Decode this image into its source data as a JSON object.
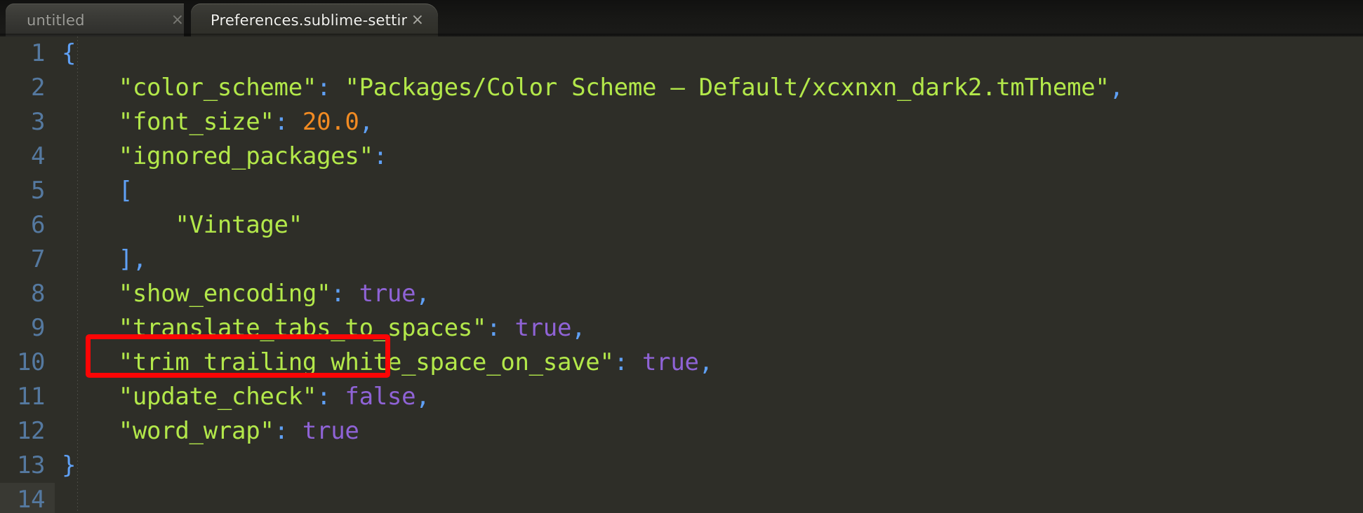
{
  "window": {
    "app": "Sublime Text",
    "theme_bg": "#2e2e28"
  },
  "tabbar": {
    "tabs": [
      {
        "label": "untitled",
        "close_glyph": "×",
        "active": false
      },
      {
        "label": "Preferences.sublime-settings",
        "close_glyph": "×",
        "active": true
      }
    ]
  },
  "editor": {
    "active_line": 14,
    "colors": {
      "background": "#2e2e28",
      "gutter_text": "#5579a0",
      "string": "#b3e84a",
      "punctuation": "#5fa0f5",
      "number": "#f28b22",
      "keyword": "#8f63d6",
      "annotation": "#fc0505"
    },
    "lines": [
      {
        "n": "1",
        "tokens": [
          {
            "t": "{",
            "c": "s-brk"
          }
        ]
      },
      {
        "n": "2",
        "tokens": [
          {
            "t": "    ",
            "c": ""
          },
          {
            "t": "\"color_scheme\"",
            "c": "s-str"
          },
          {
            "t": ":",
            "c": "s-pun"
          },
          {
            "t": " ",
            "c": ""
          },
          {
            "t": "\"Packages/Color Scheme – Default/xcxnxn_dark2.tmTheme\"",
            "c": "s-str"
          },
          {
            "t": ",",
            "c": "s-pun"
          }
        ]
      },
      {
        "n": "3",
        "tokens": [
          {
            "t": "    ",
            "c": ""
          },
          {
            "t": "\"font_size\"",
            "c": "s-str"
          },
          {
            "t": ":",
            "c": "s-pun"
          },
          {
            "t": " ",
            "c": ""
          },
          {
            "t": "20.0",
            "c": "s-num"
          },
          {
            "t": ",",
            "c": "s-pun"
          }
        ]
      },
      {
        "n": "4",
        "tokens": [
          {
            "t": "    ",
            "c": ""
          },
          {
            "t": "\"ignored_packages\"",
            "c": "s-str"
          },
          {
            "t": ":",
            "c": "s-pun"
          }
        ]
      },
      {
        "n": "5",
        "tokens": [
          {
            "t": "    ",
            "c": ""
          },
          {
            "t": "[",
            "c": "s-brk"
          }
        ]
      },
      {
        "n": "6",
        "tokens": [
          {
            "t": "        ",
            "c": ""
          },
          {
            "t": "\"Vintage\"",
            "c": "s-str"
          }
        ]
      },
      {
        "n": "7",
        "tokens": [
          {
            "t": "    ",
            "c": ""
          },
          {
            "t": "]",
            "c": "s-brk"
          },
          {
            "t": ",",
            "c": "s-pun"
          }
        ]
      },
      {
        "n": "8",
        "tokens": [
          {
            "t": "    ",
            "c": ""
          },
          {
            "t": "\"show_encoding\"",
            "c": "s-str"
          },
          {
            "t": ":",
            "c": "s-pun"
          },
          {
            "t": " ",
            "c": ""
          },
          {
            "t": "true",
            "c": "s-key"
          },
          {
            "t": ",",
            "c": "s-pun"
          }
        ]
      },
      {
        "n": "9",
        "tokens": [
          {
            "t": "    ",
            "c": ""
          },
          {
            "t": "\"translate_tabs_to_spaces\"",
            "c": "s-str"
          },
          {
            "t": ":",
            "c": "s-pun"
          },
          {
            "t": " ",
            "c": ""
          },
          {
            "t": "true",
            "c": "s-key"
          },
          {
            "t": ",",
            "c": "s-pun"
          }
        ]
      },
      {
        "n": "10",
        "tokens": [
          {
            "t": "    ",
            "c": ""
          },
          {
            "t": "\"trim_trailing_white_space_on_save\"",
            "c": "s-str"
          },
          {
            "t": ":",
            "c": "s-pun"
          },
          {
            "t": " ",
            "c": ""
          },
          {
            "t": "true",
            "c": "s-key"
          },
          {
            "t": ",",
            "c": "s-pun"
          }
        ]
      },
      {
        "n": "11",
        "tokens": [
          {
            "t": "    ",
            "c": ""
          },
          {
            "t": "\"update_check\"",
            "c": "s-str"
          },
          {
            "t": ":",
            "c": "s-pun"
          },
          {
            "t": " ",
            "c": ""
          },
          {
            "t": "false",
            "c": "s-key"
          },
          {
            "t": ",",
            "c": "s-pun"
          }
        ]
      },
      {
        "n": "12",
        "tokens": [
          {
            "t": "    ",
            "c": ""
          },
          {
            "t": "\"word_wrap\"",
            "c": "s-str"
          },
          {
            "t": ":",
            "c": "s-pun"
          },
          {
            "t": " ",
            "c": ""
          },
          {
            "t": "true",
            "c": "s-key"
          }
        ]
      },
      {
        "n": "13",
        "tokens": [
          {
            "t": "}",
            "c": "s-brk"
          }
        ]
      },
      {
        "n": "14",
        "tokens": []
      }
    ]
  },
  "annotation": {
    "target_line": "12",
    "target_text": "\"word_wrap\": true",
    "color": "#fc0505",
    "shape": "rectangle"
  }
}
